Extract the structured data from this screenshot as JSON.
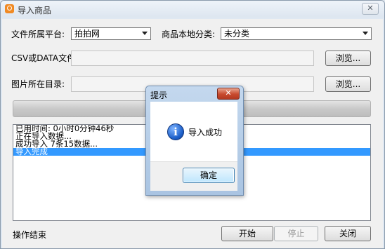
{
  "window": {
    "title": "导入商品",
    "close_glyph": "✕"
  },
  "form": {
    "platform_label": "文件所属平台:",
    "platform_value": "拍拍网",
    "category_label": "商品本地分类:",
    "category_value": "未分类",
    "csv_label": "CSV或DATA文件:",
    "csv_value": "",
    "image_dir_label": "图片所在目录:",
    "image_dir_value": "",
    "browse_label": "浏览..."
  },
  "progress": {
    "value": 1.0
  },
  "log": {
    "lines": [
      "已用时间: 0小时0分钟46秒",
      "正在导入数据...",
      "成功导入 7条15数据...",
      "导入完成"
    ],
    "selected_index": 3
  },
  "status": {
    "text": "操作结束"
  },
  "buttons": {
    "start": "开始",
    "stop": "停止",
    "close": "关闭"
  },
  "dialog": {
    "title": "提示",
    "close_glyph": "✕",
    "icon": "info-icon",
    "icon_glyph": "i",
    "message": "导入成功",
    "ok_label": "确定"
  }
}
